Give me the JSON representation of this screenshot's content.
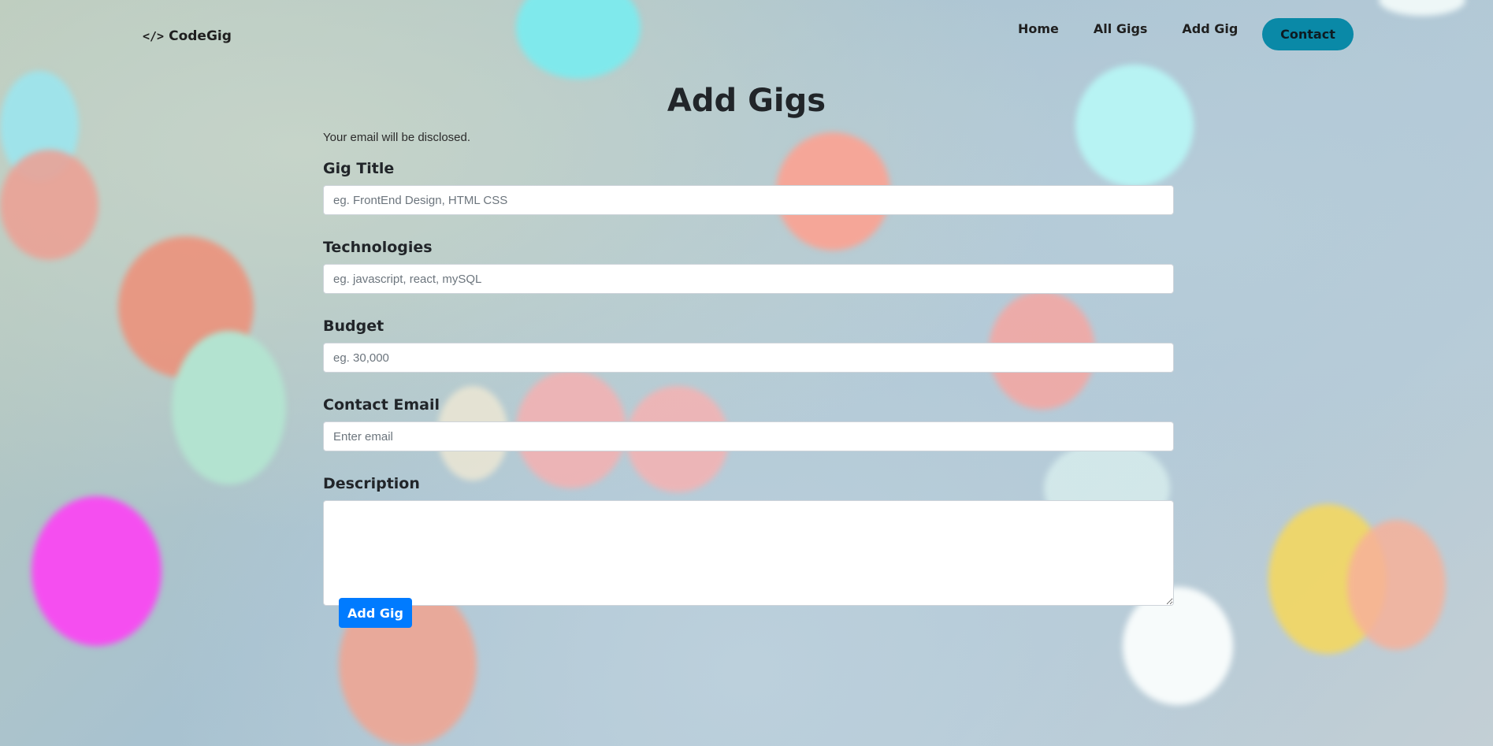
{
  "nav": {
    "brand_icon": "</>",
    "brand": "CodeGig",
    "links": [
      "Home",
      "All Gigs",
      "Add Gig"
    ],
    "contact": "Contact"
  },
  "page": {
    "title": "Add Gigs",
    "note": "Your email will be disclosed."
  },
  "form": {
    "gig_title": {
      "label": "Gig Title",
      "placeholder": "eg. FrontEnd Design, HTML CSS",
      "value": ""
    },
    "technologies": {
      "label": "Technologies",
      "placeholder": "eg. javascript, react, mySQL",
      "value": ""
    },
    "budget": {
      "label": "Budget",
      "placeholder": "eg. 30,000",
      "value": ""
    },
    "contact_email": {
      "label": "Contact Email",
      "placeholder": "Enter email",
      "value": ""
    },
    "description": {
      "label": "Description",
      "value": ""
    },
    "submit": "Add Gig"
  },
  "colors": {
    "contact_button": "#0a89a7",
    "submit_button": "#007bff"
  }
}
